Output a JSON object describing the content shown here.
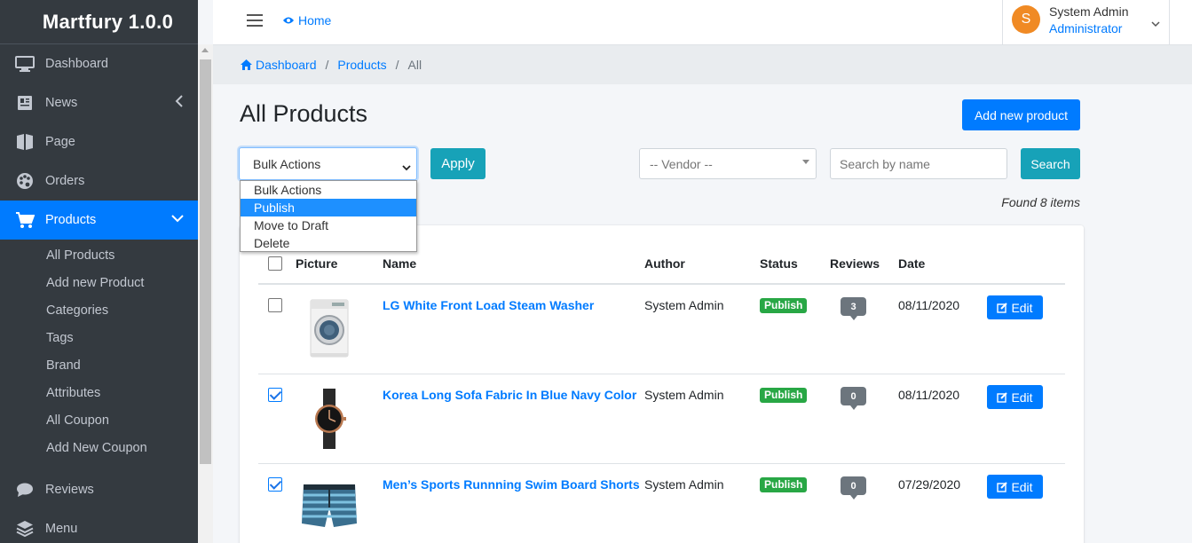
{
  "app": {
    "brand": "Martfury 1.0.0"
  },
  "sidebar": {
    "items": [
      {
        "label": "Dashboard",
        "icon": "monitor-icon"
      },
      {
        "label": "News",
        "icon": "news-icon"
      },
      {
        "label": "Page",
        "icon": "page-icon"
      },
      {
        "label": "Orders",
        "icon": "palette-icon"
      },
      {
        "label": "Products",
        "icon": "cart-icon",
        "active": true
      },
      {
        "label": "Reviews",
        "icon": "comment-icon"
      },
      {
        "label": "Menu",
        "icon": "layers-icon"
      }
    ],
    "sub_items": [
      "All Products",
      "Add new Product",
      "Categories",
      "Tags",
      "Brand",
      "Attributes",
      "All Coupon",
      "Add New Coupon"
    ]
  },
  "topbar": {
    "home_label": "Home",
    "user_initial": "S",
    "user_name": "System Admin",
    "user_role": "Administrator"
  },
  "breadcrumb": {
    "items": [
      "Dashboard",
      "Products",
      "All"
    ]
  },
  "page": {
    "title": "All Products",
    "add_button": "Add new product"
  },
  "filters": {
    "bulk_selected": "Bulk Actions",
    "bulk_options": [
      "Bulk Actions",
      "Publish",
      "Move to Draft",
      "Delete"
    ],
    "bulk_highlighted": "Publish",
    "apply_label": "Apply",
    "vendor_placeholder": "-- Vendor --",
    "search_placeholder": "Search by name",
    "search_label": "Search",
    "found_text": "Found 8 items"
  },
  "table": {
    "headers": [
      "Picture",
      "Name",
      "Author",
      "Status",
      "Reviews",
      "Date"
    ],
    "rows": [
      {
        "checked": false,
        "image": "washer-image",
        "name": "LG White Front Load Steam Washer",
        "author": "System Admin",
        "status": "Publish",
        "reviews": "3",
        "date": "08/11/2020",
        "edit": "Edit"
      },
      {
        "checked": true,
        "image": "watch-image",
        "name": "Korea Long Sofa Fabric In Blue Navy Color",
        "author": "System Admin",
        "status": "Publish",
        "reviews": "0",
        "date": "08/11/2020",
        "edit": "Edit"
      },
      {
        "checked": true,
        "image": "shorts-image",
        "name": "Men’s Sports Runnning Swim Board Shorts",
        "author": "System Admin",
        "status": "Publish",
        "reviews": "0",
        "date": "07/29/2020",
        "edit": "Edit"
      }
    ]
  },
  "colors": {
    "primary": "#007bff",
    "info": "#17a2b8",
    "success": "#28a745",
    "sidebar": "#343a40",
    "avatar": "#f08a24"
  }
}
